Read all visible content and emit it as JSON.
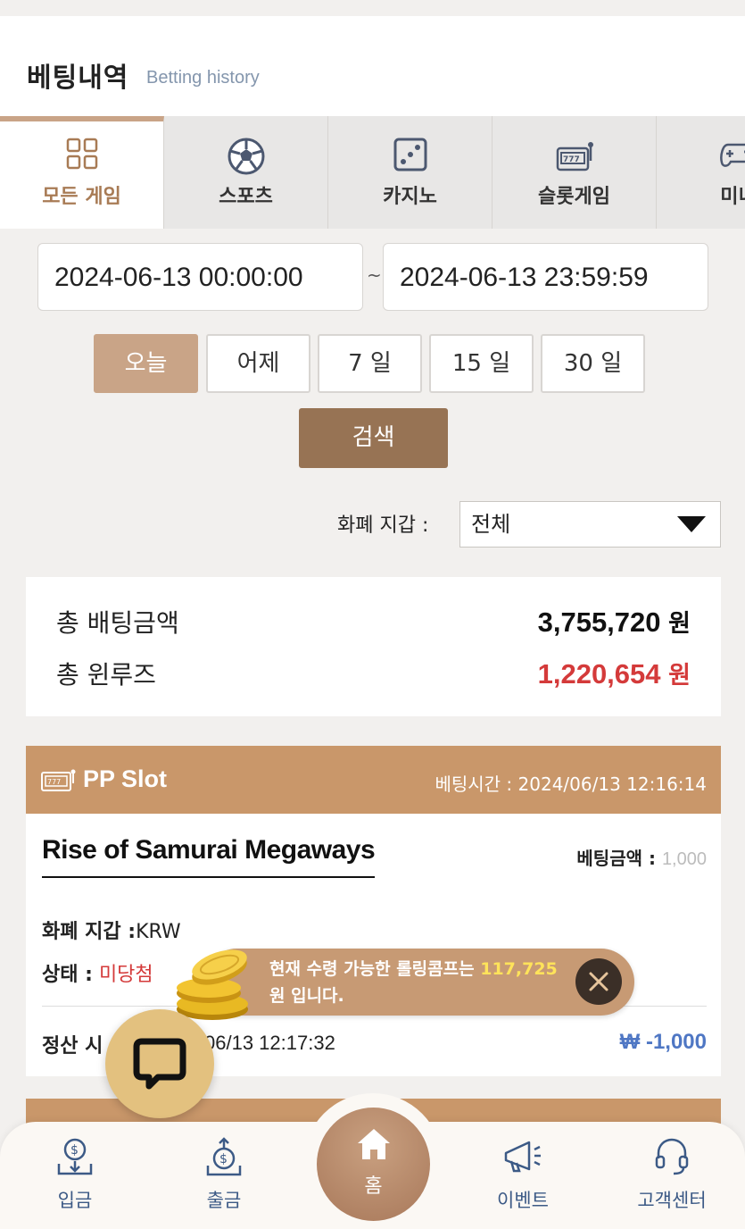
{
  "header": {
    "title": "베팅내역",
    "subtitle": "Betting history"
  },
  "tabs": [
    {
      "label": "모든 게임",
      "icon": "grid-icon",
      "active": true
    },
    {
      "label": "스포츠",
      "icon": "soccer-ball-icon",
      "active": false
    },
    {
      "label": "카지노",
      "icon": "dice-icon",
      "active": false
    },
    {
      "label": "슬롯게임",
      "icon": "slot-machine-icon",
      "active": false
    },
    {
      "label": "미니",
      "icon": "gamepad-icon",
      "active": false
    }
  ],
  "date_range": {
    "start": "2024-06-13 00:00:00",
    "separator": "~",
    "end": "2024-06-13 23:59:59"
  },
  "quick_ranges": [
    "오늘",
    "어제",
    "7 일",
    "15 일",
    "30 일"
  ],
  "search_label": "검색",
  "wallet": {
    "label": "화폐 지갑 :",
    "selected": "전체"
  },
  "summary": {
    "total_bet_label": "총 배팅금액",
    "total_bet_value": "3,755,720",
    "total_winloss_label": "총 윈루즈",
    "total_winloss_value": "1,220,654",
    "unit": "원"
  },
  "bet_card": {
    "provider": "PP Slot",
    "bet_time_label": "베팅시간 :",
    "bet_time": "2024/06/13 12:16:14",
    "game_name": "Rise of Samurai Megaways",
    "bet_amount_label": "베팅금액 :",
    "bet_amount": "1,000",
    "wallet_label": "화폐 지갑 :",
    "wallet_value": "KRW",
    "status_label": "상태 :",
    "status_value": "미당첨",
    "settle_label": "정산 시",
    "settle_time": "06/13 12:17:32",
    "result_amount": "₩ -1,000"
  },
  "toast": {
    "message_prefix": "현재 수령 가능한 롤링콤프는",
    "amount": "117,725",
    "message_suffix": "원 입니다."
  },
  "bottom_nav": [
    {
      "label": "입금",
      "icon": "deposit-icon"
    },
    {
      "label": "출금",
      "icon": "withdraw-icon"
    },
    {
      "label": "홈",
      "icon": "home-icon"
    },
    {
      "label": "이벤트",
      "icon": "megaphone-icon"
    },
    {
      "label": "고객센터",
      "icon": "headset-icon"
    }
  ],
  "colors": {
    "accent": "#c9a487",
    "brown": "#977354",
    "card_header": "#c9976a",
    "loss_blue": "#4f77c4",
    "win_red": "#d43a3a"
  }
}
